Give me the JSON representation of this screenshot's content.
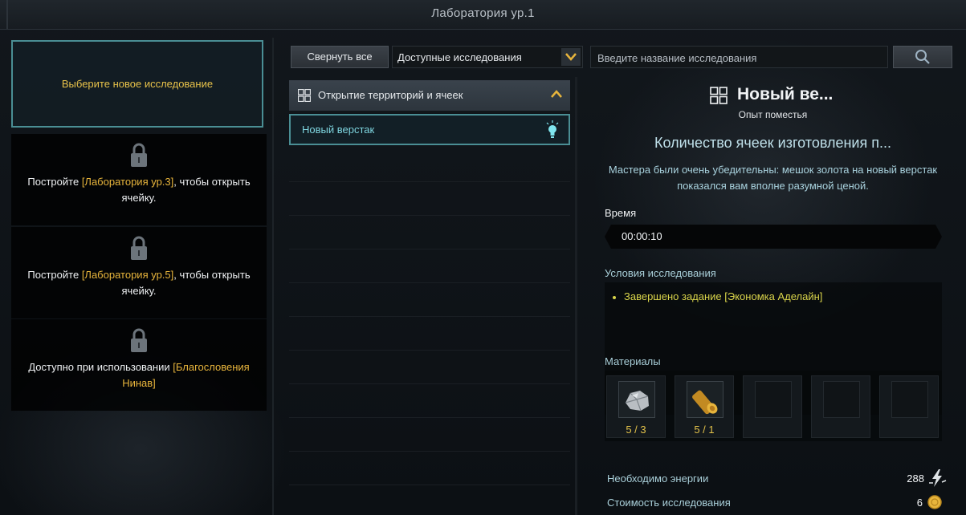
{
  "window": {
    "title": "Лаборатория ур.1"
  },
  "left_slots": {
    "active": {
      "label": "Выберите новое исследование"
    },
    "locked": [
      {
        "prefix": "Постройте ",
        "link": "[Лаборатория ур.3]",
        "suffix": ", чтобы открыть",
        "line2": "ячейку."
      },
      {
        "prefix": "Постройте ",
        "link": "[Лаборатория ур.5]",
        "suffix": ", чтобы открыть",
        "line2": "ячейку."
      },
      {
        "prefix": "Доступно при использовании ",
        "link": "[Благословения",
        "suffix": "",
        "line2": "Нинав]"
      }
    ]
  },
  "toolbar": {
    "collapse_label": "Свернуть все",
    "filter_value": "Доступные исследования",
    "search_placeholder": "Введите название исследования"
  },
  "research_list": {
    "category": "Открытие территорий и ячеек",
    "items": [
      {
        "label": "Новый верстак"
      }
    ]
  },
  "detail": {
    "name": "Новый ве...",
    "subtitle": "Опыт поместья",
    "heading": "Количество ячеек изготовления п...",
    "description_line1": "Мастера были очень убедительны: мешок золота на новый верстак",
    "description_line2": "показался вам вполне разумной ценой.",
    "time_label": "Время",
    "time_value": "00:00:10",
    "conditions_label": "Условия исследования",
    "conditions": [
      "Завершено задание [Экономка Аделайн]"
    ],
    "materials_label": "Материалы",
    "materials": [
      {
        "icon": "ore-icon",
        "count": "5 / 3"
      },
      {
        "icon": "timber-icon",
        "count": "5 / 1"
      },
      {
        "icon": "empty",
        "count": ""
      },
      {
        "icon": "empty",
        "count": ""
      },
      {
        "icon": "empty",
        "count": ""
      }
    ],
    "energy_label": "Необходимо энергии",
    "energy_value": "288",
    "cost_label": "Стоимость исследования",
    "cost_value": "6"
  },
  "colors": {
    "accent_teal": "#4a8e94",
    "gold_text": "#e8b53c",
    "condition_yellow": "#d9d44a",
    "info_blue": "#a9cfd9"
  }
}
